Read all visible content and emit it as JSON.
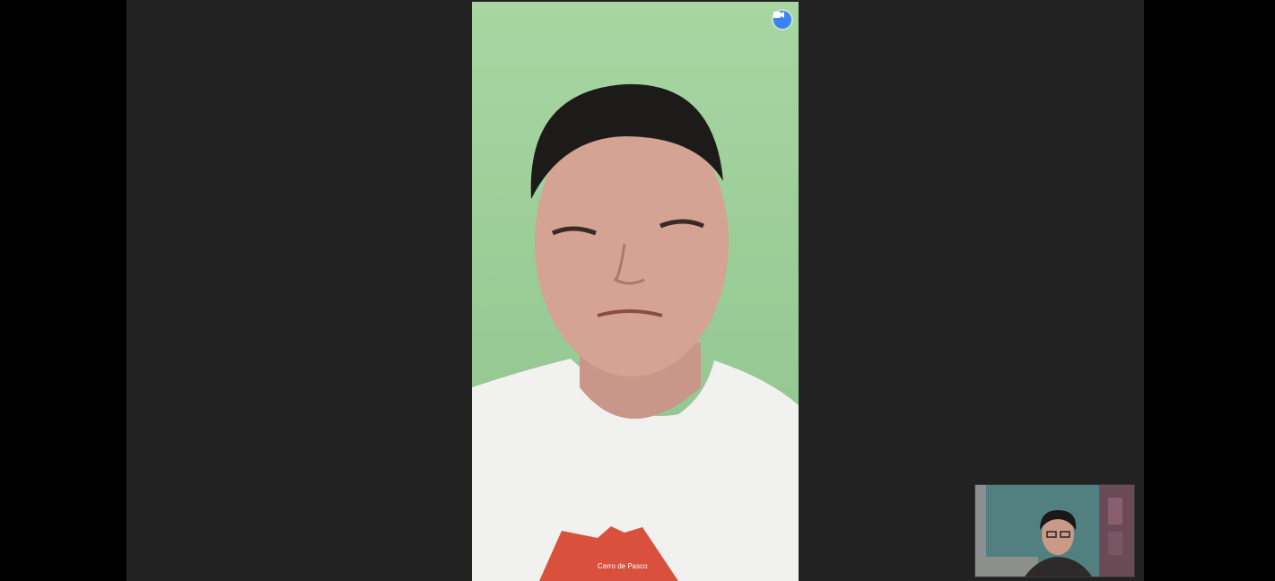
{
  "app": {
    "kind": "video-call"
  },
  "main_participant": {
    "video_icon": "video-camera-icon",
    "shirt_print": "Cerro de Pasco"
  },
  "self_view": {
    "name_label": "",
    "video_icon": "self-video-feed"
  },
  "colors": {
    "window_bg": "#222222",
    "outer_bg": "#000000",
    "main_wall": "#9fcf9b",
    "accent": "#3b82f6",
    "shirt_logo": "#d9503d"
  }
}
